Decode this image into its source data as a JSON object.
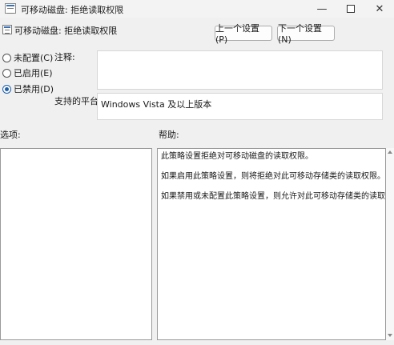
{
  "window": {
    "title": "可移动磁盘: 拒绝读取权限",
    "minimize_glyph": "—",
    "close_glyph": "✕"
  },
  "header": {
    "title": "可移动磁盘: 拒绝读取权限",
    "prev_button": "上一个设置(P)",
    "next_button": "下一个设置(N)"
  },
  "state": {
    "options": [
      {
        "label": "未配置(C)",
        "checked": false
      },
      {
        "label": "已启用(E)",
        "checked": false
      },
      {
        "label": "已禁用(D)",
        "checked": true
      }
    ]
  },
  "comment": {
    "label": "注释:",
    "value": ""
  },
  "platform": {
    "label": "支持的平台:",
    "value": "Windows Vista 及以上版本"
  },
  "options_pane": {
    "label": "选项:"
  },
  "help_pane": {
    "label": "帮助:",
    "paragraphs": [
      "此策略设置拒绝对可移动磁盘的读取权限。",
      "如果启用此策略设置，则将拒绝对此可移动存储类的读取权限。",
      "如果禁用或未配置此策略设置，则允许对此可移动存储类的读取权限。"
    ]
  }
}
